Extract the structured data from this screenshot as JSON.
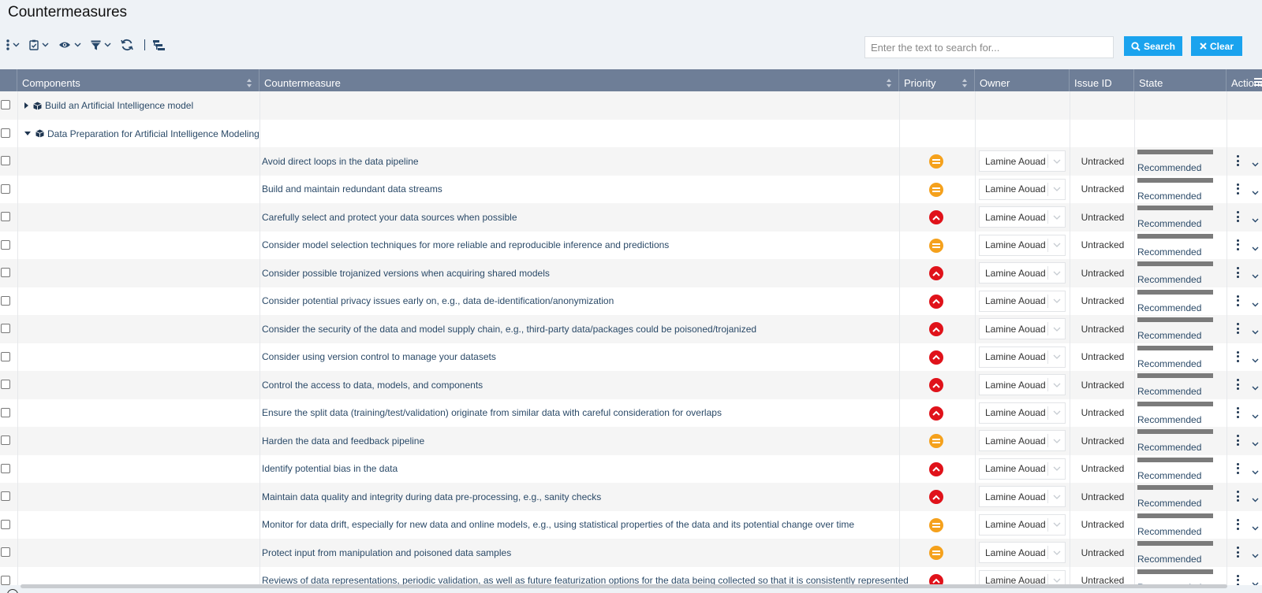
{
  "page": {
    "title": "Countermeasures"
  },
  "toolbar": {
    "items": [
      "more-actions",
      "bulk-select",
      "view",
      "filter",
      "refresh",
      "hierarchy"
    ]
  },
  "search": {
    "placeholder": "Enter the text to search for...",
    "search_label": "Search",
    "clear_label": "Clear"
  },
  "table": {
    "columns": [
      "Components",
      "Countermeasure",
      "Priority",
      "Owner",
      "Issue ID",
      "State",
      "Actions"
    ],
    "groups": [
      {
        "label": "Build an Artificial Intelligence model",
        "expanded": false
      },
      {
        "label": "Data Preparation for Artificial Intelligence Modeling",
        "expanded": true
      }
    ],
    "rows": [
      {
        "countermeasure": "Avoid direct loops in the data pipeline",
        "priority": "medium",
        "owner": "Lamine Aouad",
        "issue_id": "Untracked",
        "state": "Recommended"
      },
      {
        "countermeasure": "Build and maintain redundant data streams",
        "priority": "medium",
        "owner": "Lamine Aouad",
        "issue_id": "Untracked",
        "state": "Recommended"
      },
      {
        "countermeasure": "Carefully select and protect your data sources when possible",
        "priority": "high",
        "owner": "Lamine Aouad",
        "issue_id": "Untracked",
        "state": "Recommended"
      },
      {
        "countermeasure": "Consider model selection techniques for more reliable and reproducible inference and predictions",
        "priority": "medium",
        "owner": "Lamine Aouad",
        "issue_id": "Untracked",
        "state": "Recommended"
      },
      {
        "countermeasure": "Consider possible trojanized versions when acquiring shared models",
        "priority": "high",
        "owner": "Lamine Aouad",
        "issue_id": "Untracked",
        "state": "Recommended"
      },
      {
        "countermeasure": "Consider potential privacy issues early on, e.g., data de-identification/anonymization",
        "priority": "high",
        "owner": "Lamine Aouad",
        "issue_id": "Untracked",
        "state": "Recommended"
      },
      {
        "countermeasure": "Consider the security of the data and model supply chain, e.g., third-party data/packages could be poisoned/trojanized",
        "priority": "high",
        "owner": "Lamine Aouad",
        "issue_id": "Untracked",
        "state": "Recommended"
      },
      {
        "countermeasure": "Consider using version control to manage your datasets",
        "priority": "high",
        "owner": "Lamine Aouad",
        "issue_id": "Untracked",
        "state": "Recommended"
      },
      {
        "countermeasure": "Control the access to data, models, and components",
        "priority": "high",
        "owner": "Lamine Aouad",
        "issue_id": "Untracked",
        "state": "Recommended"
      },
      {
        "countermeasure": "Ensure the split data (training/test/validation) originate from similar data with careful consideration for overlaps",
        "priority": "high",
        "owner": "Lamine Aouad",
        "issue_id": "Untracked",
        "state": "Recommended"
      },
      {
        "countermeasure": "Harden the data and feedback pipeline",
        "priority": "medium",
        "owner": "Lamine Aouad",
        "issue_id": "Untracked",
        "state": "Recommended"
      },
      {
        "countermeasure": "Identify potential bias in the data",
        "priority": "high",
        "owner": "Lamine Aouad",
        "issue_id": "Untracked",
        "state": "Recommended"
      },
      {
        "countermeasure": "Maintain data quality and integrity during data pre-processing, e.g., sanity checks",
        "priority": "high",
        "owner": "Lamine Aouad",
        "issue_id": "Untracked",
        "state": "Recommended"
      },
      {
        "countermeasure": "Monitor for data drift, especially for new data and online models, e.g., using statistical properties of the data and its potential change over time",
        "priority": "medium",
        "owner": "Lamine Aouad",
        "issue_id": "Untracked",
        "state": "Recommended"
      },
      {
        "countermeasure": "Protect input from manipulation and poisoned data samples",
        "priority": "medium",
        "owner": "Lamine Aouad",
        "issue_id": "Untracked",
        "state": "Recommended"
      },
      {
        "countermeasure": "Reviews of data representations, periodic validation, as well as future featurization options for the data being collected so that it is consistently represented",
        "priority": "high",
        "owner": "Lamine Aouad",
        "issue_id": "Untracked",
        "state": "Recommended"
      }
    ]
  },
  "colors": {
    "header_bg": "#6e7e97",
    "accent": "#1aa3ee",
    "priority_medium": "#f5a11c",
    "priority_high": "#e0121a",
    "state_bar": "#7b7b7b"
  }
}
